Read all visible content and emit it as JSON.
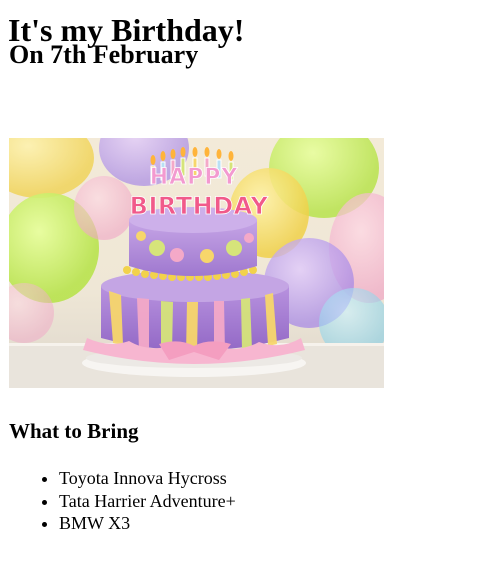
{
  "page": {
    "title": "It's my Birthday!",
    "subtitle": "On 7th February",
    "image": {
      "topper_line1": "HAPPY",
      "topper_line2": "BIRTHDAY"
    },
    "section_title": "What to Bring",
    "items": [
      "Toyota Innova Hycross",
      "Tata Harrier Adventure+",
      "BMW X3"
    ]
  },
  "colors": {
    "text": "#000000",
    "background": "#ffffff",
    "cake_top": "#b48fd6",
    "cake_bottom": "#a779d0",
    "ribbon_pink": "#f4a9c8"
  },
  "icons": [
    "bullet-disc"
  ]
}
